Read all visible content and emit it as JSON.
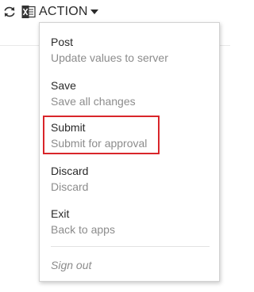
{
  "toolbar": {
    "refresh_icon": "refresh-icon",
    "excel_icon": "excel-icon",
    "action_label": "ACTION",
    "action_caret_icon": "caret-down-icon"
  },
  "menu": {
    "items": [
      {
        "title": "Post",
        "description": "Update values to server"
      },
      {
        "title": "Save",
        "description": "Save all changes"
      },
      {
        "title": "Submit",
        "description": "Submit for approval"
      },
      {
        "title": "Discard",
        "description": "Discard"
      },
      {
        "title": "Exit",
        "description": "Back to apps"
      }
    ],
    "sign_out_label": "Sign out"
  },
  "colors": {
    "highlight_border": "#d9252a",
    "description_text": "#8c8c8c",
    "excel_green": "#1f7244"
  }
}
